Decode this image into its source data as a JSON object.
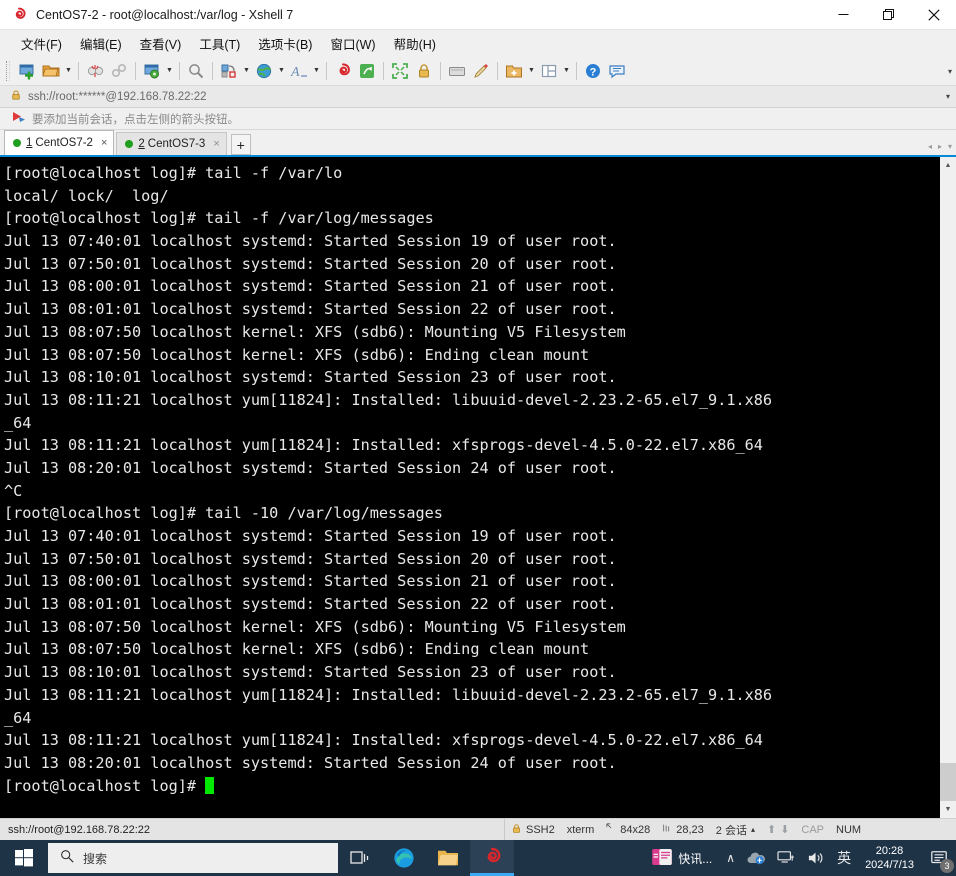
{
  "window": {
    "title": "CentOS7-2 - root@localhost:/var/log - Xshell 7",
    "app_icon": "xshell-spiral-icon",
    "minimize_label": "─",
    "maximize_label": "❐",
    "close_label": "✕"
  },
  "menubar": {
    "items": [
      {
        "label": "文件(F)",
        "name": "menu-file"
      },
      {
        "label": "编辑(E)",
        "name": "menu-edit"
      },
      {
        "label": "查看(V)",
        "name": "menu-view"
      },
      {
        "label": "工具(T)",
        "name": "menu-tools"
      },
      {
        "label": "选项卡(B)",
        "name": "menu-tabs"
      },
      {
        "label": "窗口(W)",
        "name": "menu-window"
      },
      {
        "label": "帮助(H)",
        "name": "menu-help"
      }
    ]
  },
  "toolbar": {
    "overflow_label": "▾",
    "buttons": [
      "new-session-icon",
      "open-folder-icon",
      "disconnect-icon",
      "link-icon",
      "session-properties-icon",
      "find-icon",
      "transfer-icon",
      "globe-icon",
      "font-icon",
      "xshell-icon",
      "xftp-icon",
      "fullscreen-icon",
      "lock-icon",
      "keyboard-icon",
      "highlight-icon",
      "add-folder-icon",
      "layout-icon",
      "help-icon",
      "feedback-icon"
    ]
  },
  "addressbar": {
    "icon": "lock-icon",
    "value": "ssh://root:******@192.168.78.22:22",
    "dropdown_label": "▾"
  },
  "hintbar": {
    "icon": "red-arrow-icon",
    "text": "要添加当前会话，点击左侧的箭头按钮。"
  },
  "tabs": {
    "items": [
      {
        "num": "1",
        "label": "CentOS7-2",
        "active": true,
        "close_label": "×",
        "dot_color": "#1f9e1f"
      },
      {
        "num": "2",
        "label": "CentOS7-3",
        "active": false,
        "close_label": "×",
        "dot_color": "#1f9e1f"
      }
    ],
    "add_label": "+",
    "nav_left": "◂",
    "nav_right": "▸",
    "nav_menu": "▾"
  },
  "terminal": {
    "prompt": "[root@localhost log]#",
    "cursor_color": "#00e800",
    "lines": [
      "[root@localhost log]# tail -f /var/lo",
      "local/ lock/  log/",
      "[root@localhost log]# tail -f /var/log/messages",
      "Jul 13 07:40:01 localhost systemd: Started Session 19 of user root.",
      "Jul 13 07:50:01 localhost systemd: Started Session 20 of user root.",
      "Jul 13 08:00:01 localhost systemd: Started Session 21 of user root.",
      "Jul 13 08:01:01 localhost systemd: Started Session 22 of user root.",
      "Jul 13 08:07:50 localhost kernel: XFS (sdb6): Mounting V5 Filesystem",
      "Jul 13 08:07:50 localhost kernel: XFS (sdb6): Ending clean mount",
      "Jul 13 08:10:01 localhost systemd: Started Session 23 of user root.",
      "Jul 13 08:11:21 localhost yum[11824]: Installed: libuuid-devel-2.23.2-65.el7_9.1.x86",
      "_64",
      "Jul 13 08:11:21 localhost yum[11824]: Installed: xfsprogs-devel-4.5.0-22.el7.x86_64",
      "Jul 13 08:20:01 localhost systemd: Started Session 24 of user root.",
      "^C",
      "[root@localhost log]# tail -10 /var/log/messages",
      "Jul 13 07:40:01 localhost systemd: Started Session 19 of user root.",
      "Jul 13 07:50:01 localhost systemd: Started Session 20 of user root.",
      "Jul 13 08:00:01 localhost systemd: Started Session 21 of user root.",
      "Jul 13 08:01:01 localhost systemd: Started Session 22 of user root.",
      "Jul 13 08:07:50 localhost kernel: XFS (sdb6): Mounting V5 Filesystem",
      "Jul 13 08:07:50 localhost kernel: XFS (sdb6): Ending clean mount",
      "Jul 13 08:10:01 localhost systemd: Started Session 23 of user root.",
      "Jul 13 08:11:21 localhost yum[11824]: Installed: libuuid-devel-2.23.2-65.el7_9.1.x86",
      "_64",
      "Jul 13 08:11:21 localhost yum[11824]: Installed: xfsprogs-devel-4.5.0-22.el7.x86_64",
      "Jul 13 08:20:01 localhost systemd: Started Session 24 of user root."
    ],
    "last_line": "[root@localhost log]# "
  },
  "scrollbar": {
    "up_label": "▲",
    "down_label": "▼"
  },
  "statusbar": {
    "session": "ssh://root@192.168.78.22:22",
    "protocol": "SSH2",
    "term_type": "xterm",
    "size": "84x28",
    "cursor_pos": "28,23",
    "sessions": "2 会话",
    "sessions_caret": "▴",
    "caps": "CAP",
    "num": "NUM",
    "up_arrow": "⬆",
    "down_arrow": "⬇"
  },
  "taskbar": {
    "start_label": "start-windows-icon",
    "search_placeholder": "搜索",
    "task_view": "task-view-icon",
    "edge": "edge-browser-icon",
    "explorer": "file-explorer-icon",
    "xshell": "xshell-taskbar-icon",
    "news_label": "快讯...",
    "news_icon": "news-icon",
    "chevron_up": "∧",
    "cloud_icon": "onedrive-icon",
    "network_icon": "network-icon",
    "volume_icon": "volume-icon",
    "ime_label": "英",
    "clock_time": "20:28",
    "clock_date": "2024/7/13",
    "notif_count": "3"
  }
}
